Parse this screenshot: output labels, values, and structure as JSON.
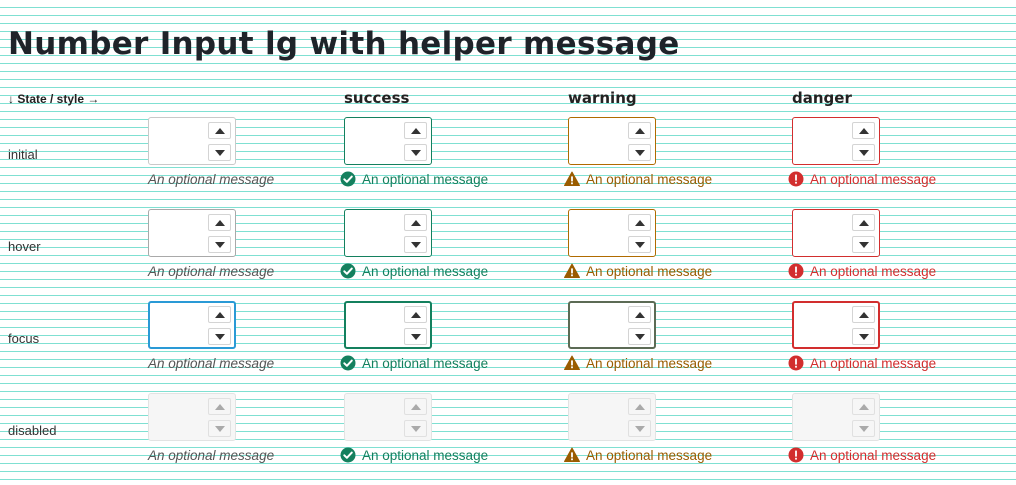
{
  "title": "Number Input lg with helper message",
  "corner_label": "↓ State / style →",
  "columns": [
    {
      "key": "default",
      "label": ""
    },
    {
      "key": "success",
      "label": "success"
    },
    {
      "key": "warning",
      "label": "warning"
    },
    {
      "key": "danger",
      "label": "danger"
    }
  ],
  "rows": [
    {
      "key": "initial",
      "label": "initial"
    },
    {
      "key": "hover",
      "label": "hover"
    },
    {
      "key": "focus",
      "label": "focus"
    },
    {
      "key": "disabled",
      "label": "disabled"
    }
  ],
  "helper_message": "An optional message",
  "icons": {
    "default": "",
    "success": "check-circle-icon",
    "warning": "warning-triangle-icon",
    "danger": "error-circle-icon"
  },
  "colors": {
    "grid_lines": "#7fe0d2",
    "focus_default": "#2a9ad6",
    "success": "#14805e",
    "warning": "#9a5c00",
    "danger": "#d22e2e"
  }
}
